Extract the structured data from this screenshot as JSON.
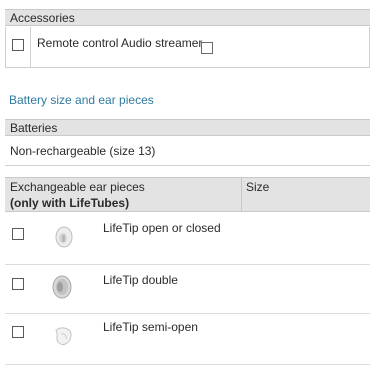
{
  "accessories": {
    "header": "Accessories",
    "items": [
      {
        "label": "Remote control Audio streamer",
        "checked": false
      },
      {
        "label": "",
        "checked": false
      }
    ]
  },
  "battery_section_title": "Battery size and ear pieces",
  "batteries": {
    "header": "Batteries",
    "value": "Non-rechargeable (size 13)"
  },
  "ear_pieces": {
    "header_line1": "Exchangeable ear pieces",
    "header_line2": "(only with LifeTubes)",
    "size_header": "Size",
    "items": [
      {
        "label": "LifeTip open or closed",
        "checked": false,
        "icon": "lifetip-open-icon"
      },
      {
        "label": "LifeTip double",
        "checked": false,
        "icon": "lifetip-double-icon"
      },
      {
        "label": "LifeTip semi-open",
        "checked": false,
        "icon": "lifetip-semi-open-icon"
      }
    ]
  }
}
